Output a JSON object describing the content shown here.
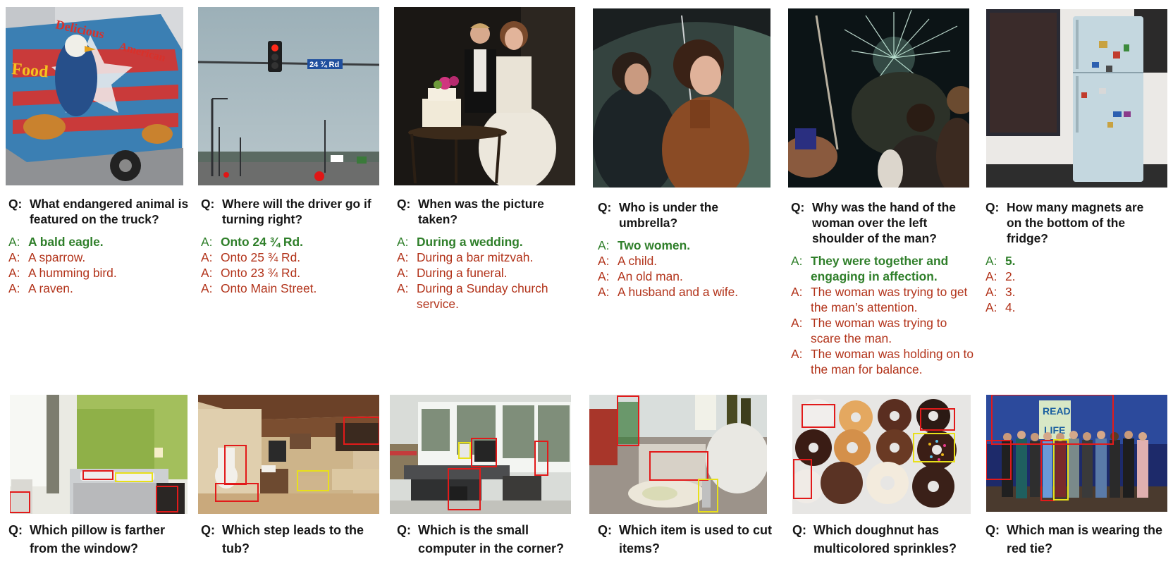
{
  "top_row": [
    {
      "scene": "food-truck",
      "question": "What endangered animal is featured on the truck?",
      "truck_text": [
        "Delicious",
        "American",
        "Food"
      ],
      "answers": [
        {
          "text": "A bald eagle.",
          "correct": true
        },
        {
          "text": "A sparrow.",
          "correct": false
        },
        {
          "text": "A humming bird.",
          "correct": false
        },
        {
          "text": "A raven.",
          "correct": false
        }
      ]
    },
    {
      "scene": "traffic-light",
      "question": "Where will the driver go if turning right?",
      "sign_text": "24 ¾ Rd",
      "answers": [
        {
          "text": "Onto 24 ¾ Rd.",
          "correct": true
        },
        {
          "text": "Onto 25 ¾ Rd.",
          "correct": false
        },
        {
          "text": "Onto 23 ¾ Rd.",
          "correct": false
        },
        {
          "text": "Onto Main Street.",
          "correct": false
        }
      ]
    },
    {
      "scene": "wedding-cake",
      "question": "When was the picture taken?",
      "answers": [
        {
          "text": "During a wedding.",
          "correct": true
        },
        {
          "text": "During a bar mitzvah.",
          "correct": false
        },
        {
          "text": "During a funeral.",
          "correct": false
        },
        {
          "text": "During a Sunday church service.",
          "correct": false
        }
      ]
    },
    {
      "scene": "umbrella",
      "question": "Who is under the umbrella?",
      "answers": [
        {
          "text": "Two women.",
          "correct": true
        },
        {
          "text": "A child.",
          "correct": false
        },
        {
          "text": "An old man.",
          "correct": false
        },
        {
          "text": "A husband and a wife.",
          "correct": false
        }
      ]
    },
    {
      "scene": "fireworks",
      "question": "Why was the hand of the woman over the left shoulder of the man?",
      "answers": [
        {
          "text": "They were together and engaging in affection.",
          "correct": true
        },
        {
          "text": "The woman was trying to get the man’s attention.",
          "correct": false
        },
        {
          "text": "The woman was trying to scare the man.",
          "correct": false
        },
        {
          "text": "The woman was holding on to the man for balance.",
          "correct": false
        }
      ]
    },
    {
      "scene": "fridge",
      "question": "How many magnets are on the bottom of the fridge?",
      "answers": [
        {
          "text": "5.",
          "correct": true
        },
        {
          "text": "2.",
          "correct": false
        },
        {
          "text": "3.",
          "correct": false
        },
        {
          "text": "4.",
          "correct": false
        }
      ]
    }
  ],
  "bottom_row": [
    {
      "scene": "hotel-bedroom",
      "question": "Which pillow is farther from the window?"
    },
    {
      "scene": "bathroom",
      "question": "Which step leads to the tub?"
    },
    {
      "scene": "office",
      "question": "Which is the small computer in the corner?"
    },
    {
      "scene": "kitchen",
      "question": "Which item is used to cut items?"
    },
    {
      "scene": "doughnuts",
      "question": "Which doughnut has multicolored sprinkles?"
    },
    {
      "scene": "stage-group",
      "question": "Which man is wearing the red tie?"
    }
  ],
  "stage_banner": [
    "READ",
    "LIFE"
  ],
  "labels": {
    "q": "Q:",
    "a": "A:"
  },
  "colors": {
    "correct": "#2f7f2a",
    "wrong": "#b2331a",
    "box_red": "#e21a1a",
    "box_yellow": "#e8e01a"
  }
}
